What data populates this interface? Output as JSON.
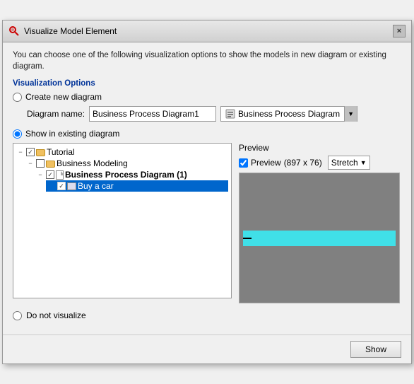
{
  "dialog": {
    "title": "Visualize Model Element",
    "close_label": "×"
  },
  "desc": {
    "text": "You can choose one of the following visualization options to show the models in new diagram or existing diagram."
  },
  "visualization_options": {
    "label": "Visualization Options",
    "create_new": {
      "label": "Create new diagram",
      "field_label": "Diagram name:",
      "diagram_name_value": "Business Process Diagram1",
      "diagram_type_label": "Business Process Diagram"
    },
    "show_existing": {
      "label": "Show in existing diagram"
    },
    "do_not_vis": {
      "label": "Do not visualize"
    }
  },
  "tree": {
    "items": [
      {
        "id": "tutorial",
        "level": 1,
        "label": "Tutorial",
        "type": "folder",
        "checked": true,
        "expanded": true,
        "bold": false
      },
      {
        "id": "business-modeling",
        "level": 2,
        "label": "Business Modeling",
        "type": "folder",
        "checked": false,
        "expanded": true,
        "bold": false
      },
      {
        "id": "bpd",
        "level": 3,
        "label": "Business Process Diagram (1)",
        "type": "doc",
        "checked": true,
        "expanded": true,
        "bold": true
      },
      {
        "id": "buy-a-car",
        "level": 4,
        "label": "Buy a car",
        "type": "img",
        "checked": true,
        "expanded": false,
        "bold": false,
        "selected": true
      }
    ]
  },
  "preview": {
    "label": "Preview",
    "check_label": "Preview",
    "dimensions": "(897 x 76)",
    "stretch_label": "Stretch",
    "stretch_arrow": "▼"
  },
  "footer": {
    "show_label": "Show"
  }
}
